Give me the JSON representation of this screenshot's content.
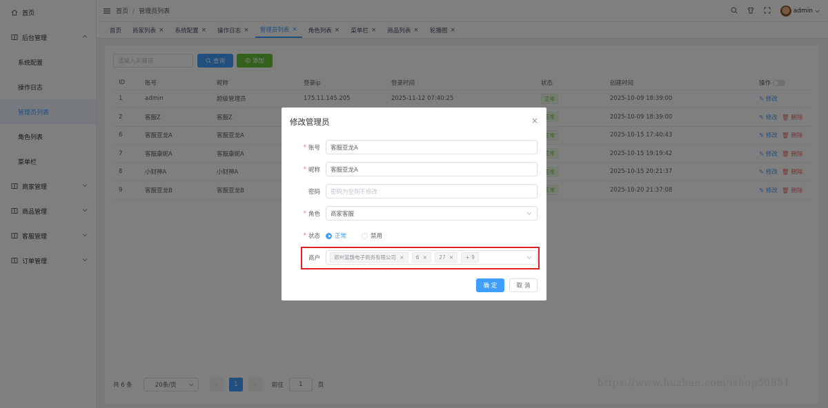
{
  "sidebar": {
    "items": [
      {
        "label": "首页",
        "icon": "home-icon"
      },
      {
        "label": "后台管理",
        "icon": "book-icon"
      },
      {
        "label": "系统配置"
      },
      {
        "label": "操作日志"
      },
      {
        "label": "管理员列表"
      },
      {
        "label": "角色列表"
      },
      {
        "label": "菜单栏"
      },
      {
        "label": "商家管理",
        "icon": "book-icon"
      },
      {
        "label": "商品管理",
        "icon": "book-icon"
      },
      {
        "label": "客服管理",
        "icon": "book-icon"
      },
      {
        "label": "订单管理",
        "icon": "book-icon"
      }
    ]
  },
  "header": {
    "breadcrumb": [
      "首页",
      "管理员列表"
    ],
    "username": "admin"
  },
  "tabs": [
    {
      "label": "首页"
    },
    {
      "label": "商家列表"
    },
    {
      "label": "系统配置"
    },
    {
      "label": "操作日志"
    },
    {
      "label": "管理员列表"
    },
    {
      "label": "角色列表"
    },
    {
      "label": "菜单栏"
    },
    {
      "label": "商品列表"
    },
    {
      "label": "轮播图"
    }
  ],
  "toolbar": {
    "search_placeholder": "请输入关键词",
    "query_label": "查询",
    "add_label": "添加"
  },
  "table": {
    "headers": [
      "ID",
      "账号",
      "昵称",
      "登录ip",
      "登录时间",
      "状态",
      "创建时间",
      "操作"
    ],
    "rows": [
      {
        "id": "1",
        "account": "admin",
        "nickname": "超级管理员",
        "ip": "175.11.145.205",
        "login_time": "2025-11-12 07:40:25",
        "status": "正常",
        "created": "2025-10-09 18:39:00",
        "ops": [
          "修改"
        ]
      },
      {
        "id": "2",
        "account": "客服Z",
        "nickname": "客服Z",
        "ip": "",
        "login_time": "",
        "status": "正常",
        "created": "2025-10-09 18:39:00",
        "ops": [
          "修改",
          "删除"
        ]
      },
      {
        "id": "6",
        "account": "客服亚龙A",
        "nickname": "客服亚龙A",
        "ip": "",
        "login_time": "",
        "status": "正常",
        "created": "2025-10-15 17:40:43",
        "ops": [
          "修改",
          "删除"
        ]
      },
      {
        "id": "7",
        "account": "客服康妮A",
        "nickname": "客服康妮A",
        "ip": "",
        "login_time": "",
        "status": "正常",
        "created": "2025-10-15 19:19:42",
        "ops": [
          "修改",
          "删除"
        ]
      },
      {
        "id": "8",
        "account": "小财神A",
        "nickname": "小财神A",
        "ip": "",
        "login_time": "",
        "status": "正常",
        "created": "2025-10-15 20:21:37",
        "ops": [
          "修改",
          "删除"
        ]
      },
      {
        "id": "9",
        "account": "客服亚龙B",
        "nickname": "客服亚龙B",
        "ip": "",
        "login_time": "",
        "status": "正常",
        "created": "2025-10-20 21:37:08",
        "ops": [
          "修改",
          "删除"
        ]
      }
    ]
  },
  "pagination": {
    "total_label": "共 6 条",
    "page_size": "20条/页",
    "current": "1",
    "goto_prefix": "前往",
    "goto_value": "1",
    "goto_suffix": "页",
    "prev": "‹",
    "next": "›"
  },
  "dialog": {
    "title": "修改管理员",
    "account_label": "账号",
    "account_value": "客服亚龙A",
    "nickname_label": "昵称",
    "nickname_value": "客服亚龙A",
    "password_label": "密码",
    "password_placeholder": "密码为空则不修改",
    "role_label": "角色",
    "role_value": "商家客服",
    "status_label": "状态",
    "status_on": "正常",
    "status_off": "禁用",
    "merchant_label": "商户",
    "merchant_chips": [
      "郑州富魏电子商务有限公司",
      "6",
      "27"
    ],
    "merchant_more": "+ 9",
    "ok_label": "确 定",
    "cancel_label": "取 消"
  },
  "watermark": "https://www.huzhan.com/ishop50851",
  "colors": {
    "primary": "#409eff",
    "success": "#67c23a",
    "danger": "#f56c6c",
    "highlight": "#e02020"
  }
}
